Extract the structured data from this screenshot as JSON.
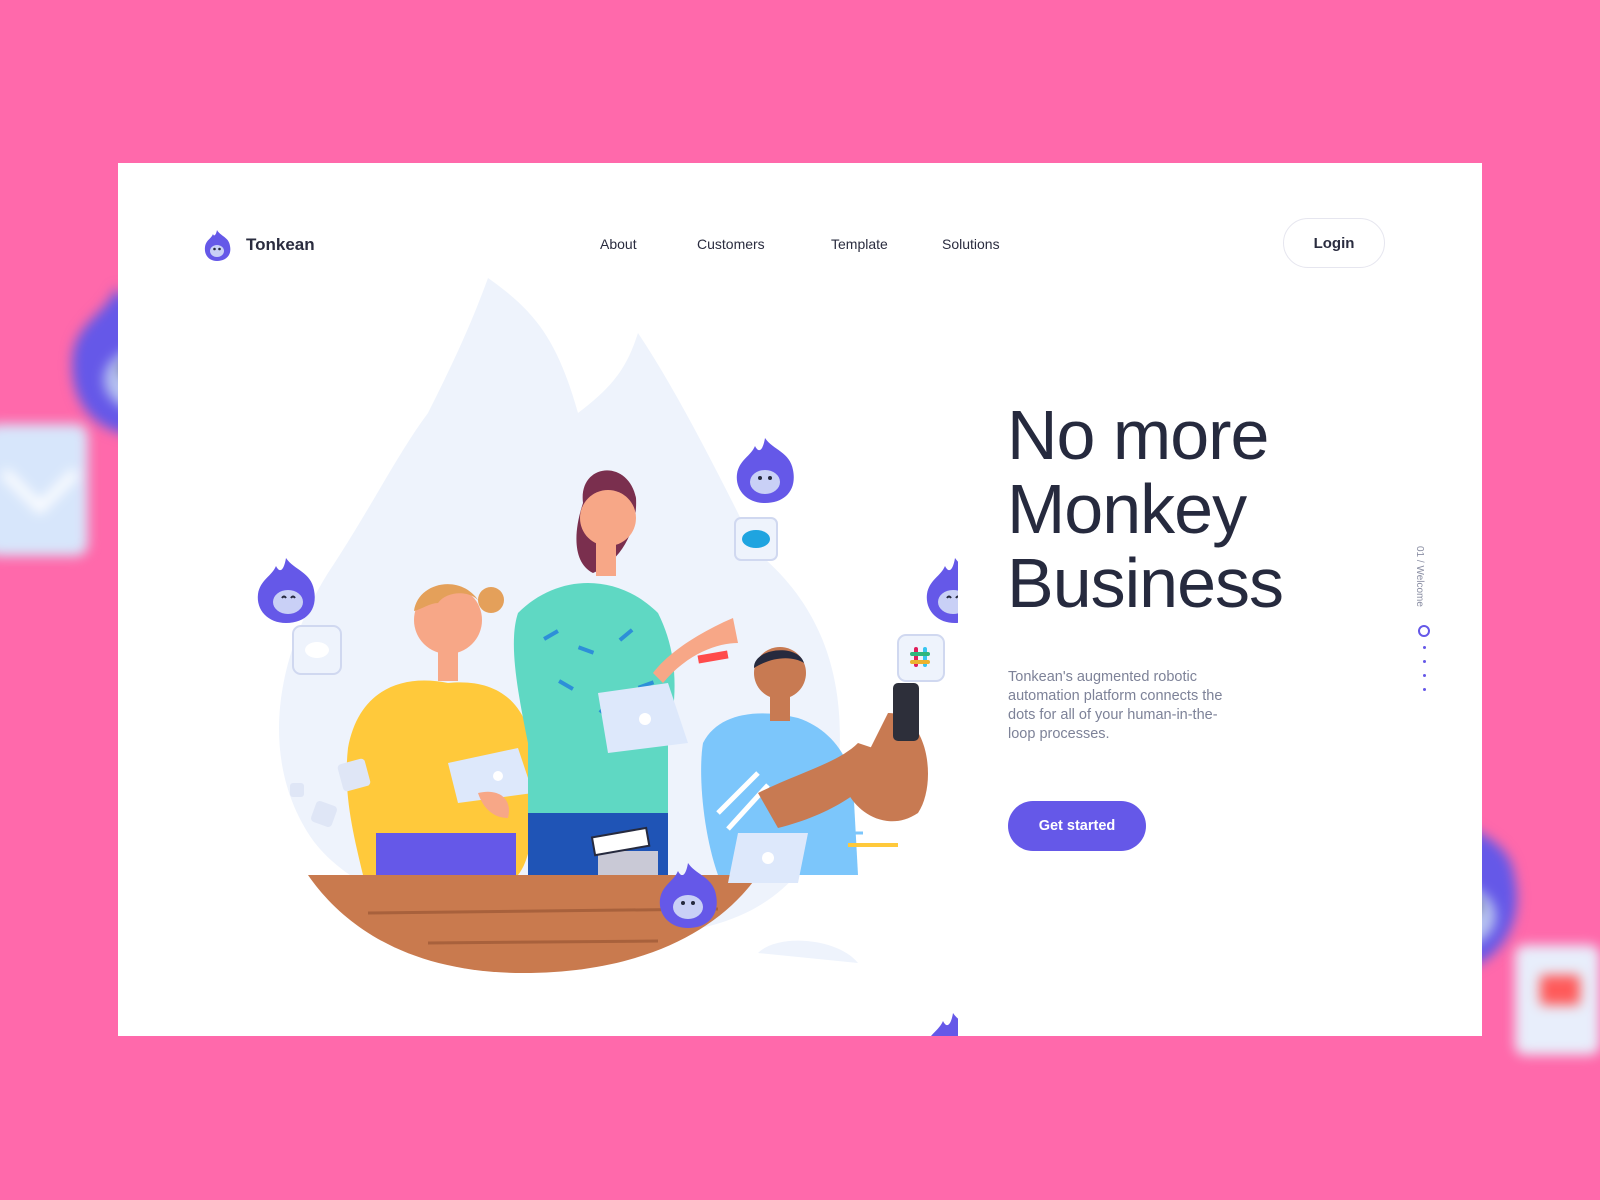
{
  "brand": {
    "name": "Tonkean",
    "logo_icon": "monkey-logo-icon"
  },
  "nav": {
    "items": [
      "About",
      "Customers",
      "Template",
      "Solutions"
    ]
  },
  "header": {
    "login_label": "Login"
  },
  "hero": {
    "title_lines": [
      "No more",
      "Monkey",
      "Business"
    ],
    "description": "Tonkean's augmented robotic automation platform connects the dots for all of your human-in-the-loop processes.",
    "cta_label": "Get started"
  },
  "slider": {
    "label": "01 / Welcome",
    "current": 1,
    "total": 4
  },
  "colors": {
    "background": "#ff69ab",
    "accent": "#6558e8",
    "text": "#262a3e",
    "muted": "#7d8298"
  }
}
